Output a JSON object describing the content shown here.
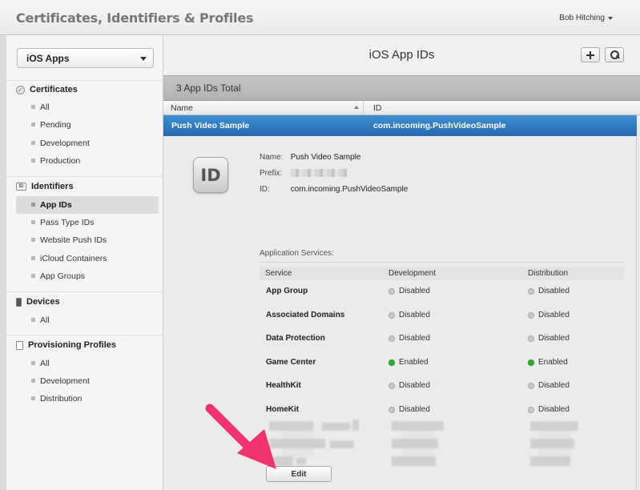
{
  "header": {
    "title": "Certificates, Identifiers & Profiles",
    "user_name": "Bob Hitching"
  },
  "sidebar": {
    "platform_select": "iOS Apps",
    "sections": [
      {
        "label": "Certificates",
        "icon": "certificate-icon",
        "items": [
          "All",
          "Pending",
          "Development",
          "Production"
        ]
      },
      {
        "label": "Identifiers",
        "icon": "id-icon",
        "items": [
          "App IDs",
          "Pass Type IDs",
          "Website Push IDs",
          "iCloud Containers",
          "App Groups"
        ]
      },
      {
        "label": "Devices",
        "icon": "device-icon",
        "items": [
          "All"
        ]
      },
      {
        "label": "Provisioning Profiles",
        "icon": "document-icon",
        "items": [
          "All",
          "Development",
          "Distribution"
        ]
      }
    ],
    "active_item": "App IDs"
  },
  "main": {
    "title": "iOS App IDs",
    "count_label": "3 App IDs Total",
    "columns": {
      "name": "Name",
      "id": "ID"
    },
    "selected_row": {
      "name": "Push Video Sample",
      "bundle_id": "com.incoming.PushVideoSample"
    },
    "detail": {
      "badge": "ID",
      "name_label": "Name:",
      "name_value": "Push Video Sample",
      "prefix_label": "Prefix:",
      "id_label": "ID:",
      "id_value": "com.incoming.PushVideoSample",
      "services_title": "Application Services:",
      "service_headers": {
        "service": "Service",
        "development": "Development",
        "distribution": "Distribution"
      },
      "services": [
        {
          "name": "App Group",
          "development": "Disabled",
          "distribution": "Disabled"
        },
        {
          "name": "Associated Domains",
          "development": "Disabled",
          "distribution": "Disabled"
        },
        {
          "name": "Data Protection",
          "development": "Disabled",
          "distribution": "Disabled"
        },
        {
          "name": "Game Center",
          "development": "Enabled",
          "distribution": "Enabled"
        },
        {
          "name": "HealthKit",
          "development": "Disabled",
          "distribution": "Disabled"
        },
        {
          "name": "HomeKit",
          "development": "Disabled",
          "distribution": "Disabled"
        }
      ],
      "edit_label": "Edit"
    }
  },
  "colors": {
    "selection_blue": "#2a74bd",
    "enabled_green": "#2cb52c",
    "disabled_gray": "#c9c9c9",
    "annotation_arrow": "#f0336e"
  }
}
